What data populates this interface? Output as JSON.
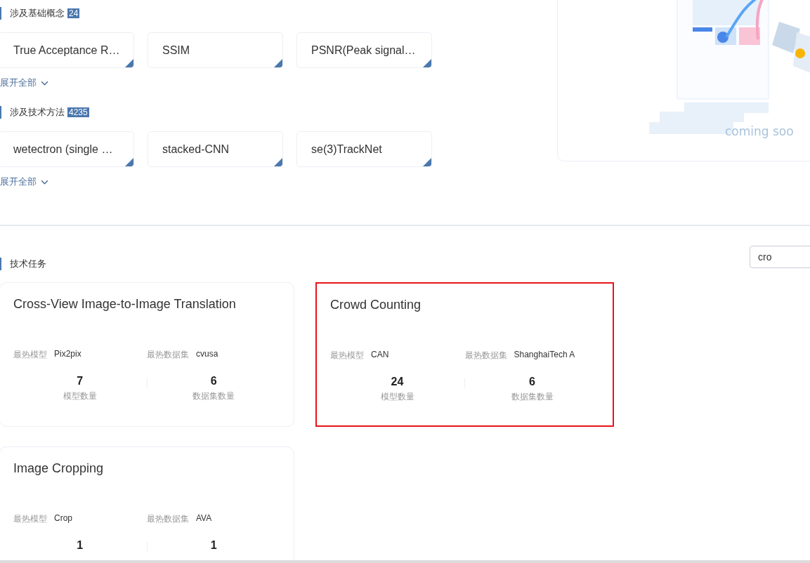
{
  "concepts": {
    "title": "涉及基础概念",
    "count": "24",
    "items": [
      "True Acceptance R…",
      "SSIM",
      "PSNR(Peak signal…"
    ],
    "expand": "展开全部"
  },
  "methods": {
    "title": "涉及技术方法",
    "count": "4235",
    "items": [
      "wetectron (single …",
      "stacked-CNN",
      "se(3)TrackNet"
    ],
    "expand": "展开全部"
  },
  "illustration": {
    "caption": "coming soo"
  },
  "tasks_section": {
    "title": "技术任务",
    "search": {
      "value": "cro"
    }
  },
  "tasks": [
    {
      "title": "Cross-View Image-to-Image Translation",
      "highlighted": false,
      "hot_model_label": "最热模型",
      "hot_model": "Pix2pix",
      "hot_dataset_label": "最热数据集",
      "hot_dataset": "cvusa",
      "model_count": "7",
      "model_count_label": "模型数量",
      "dataset_count": "6",
      "dataset_count_label": "数据集数量"
    },
    {
      "title": "Crowd Counting",
      "highlighted": true,
      "hot_model_label": "最热模型",
      "hot_model": "CAN",
      "hot_dataset_label": "最热数据集",
      "hot_dataset": "ShanghaiTech A",
      "model_count": "24",
      "model_count_label": "模型数量",
      "dataset_count": "6",
      "dataset_count_label": "数据集数量"
    },
    {
      "title": "Image Cropping",
      "highlighted": false,
      "hot_model_label": "最热模型",
      "hot_model": "Crop",
      "hot_dataset_label": "最热数据集",
      "hot_dataset": "AVA",
      "model_count": "1",
      "dataset_count": "1"
    }
  ]
}
